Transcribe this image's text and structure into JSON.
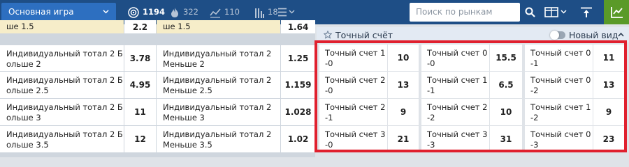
{
  "toolbar": {
    "game_select": "Основная игра",
    "stats": [
      {
        "icon": "live-target-icon",
        "value": "1194",
        "active": true
      },
      {
        "icon": "flame-icon",
        "value": "322",
        "active": false
      },
      {
        "icon": "line-chart-icon",
        "value": "110",
        "active": false
      },
      {
        "icon": "bar-chart-icon",
        "value": "18",
        "active": false
      }
    ],
    "search_placeholder": "Поиск по рынкам",
    "icons": [
      "menu-list-icon",
      "search-icon",
      "layout-columns-icon",
      "pin-top-icon",
      "stats-green-icon"
    ]
  },
  "left_table": {
    "rows": [
      {
        "over_name": "ше 1.5",
        "over_odd": "2.2",
        "under_name": "ше 1.5",
        "under_odd": "1.64"
      },
      {
        "over_name": "Индивидуальный тотал 2 Больше 2",
        "over_odd": "3.78",
        "under_name": "Индивидуальный тотал 2 Меньше 2",
        "under_odd": "1.25"
      },
      {
        "over_name": "Индивидуальный тотал 2 Больше 2.5",
        "over_odd": "4.95",
        "under_name": "Индивидуальный тотал 2 Меньше 2.5",
        "under_odd": "1.159"
      },
      {
        "over_name": "Индивидуальный тотал 2 Больше 3",
        "over_odd": "11",
        "under_name": "Индивидуальный тотал 2 Меньше 3",
        "under_odd": "1.028"
      },
      {
        "over_name": "Индивидуальный тотал 2 Больше 3.5",
        "over_odd": "12",
        "under_name": "Индивидуальный тотал 2 Меньше 3.5",
        "under_odd": "1.02"
      }
    ]
  },
  "exact_score": {
    "title": "Точный счёт",
    "new_view_label": "Новый вид",
    "rows": [
      [
        {
          "name": "Точный счет 1-0",
          "odd": "10"
        },
        {
          "name": "Точный счет 0-0",
          "odd": "15.5"
        },
        {
          "name": "Точный счет 0-1",
          "odd": "11"
        }
      ],
      [
        {
          "name": "Точный счет 2-0",
          "odd": "13"
        },
        {
          "name": "Точный счет 1-1",
          "odd": "6.5"
        },
        {
          "name": "Точный счет 0-2",
          "odd": "13"
        }
      ],
      [
        {
          "name": "Точный счет 2-1",
          "odd": "9"
        },
        {
          "name": "Точный счет 2-2",
          "odd": "10"
        },
        {
          "name": "Точный счет 1-2",
          "odd": "9"
        }
      ],
      [
        {
          "name": "Точный счет 3-0",
          "odd": "21"
        },
        {
          "name": "Точный счет 3-3",
          "odd": "31"
        },
        {
          "name": "Точный счет 0-3",
          "odd": "23"
        }
      ]
    ]
  },
  "colors": {
    "toolbar_bg": "#1e4e86",
    "select_bg": "#2d6fc0",
    "selected_cell": "#f6edc9",
    "highlight_border": "#e0202e",
    "green_button": "#5a9a28"
  }
}
